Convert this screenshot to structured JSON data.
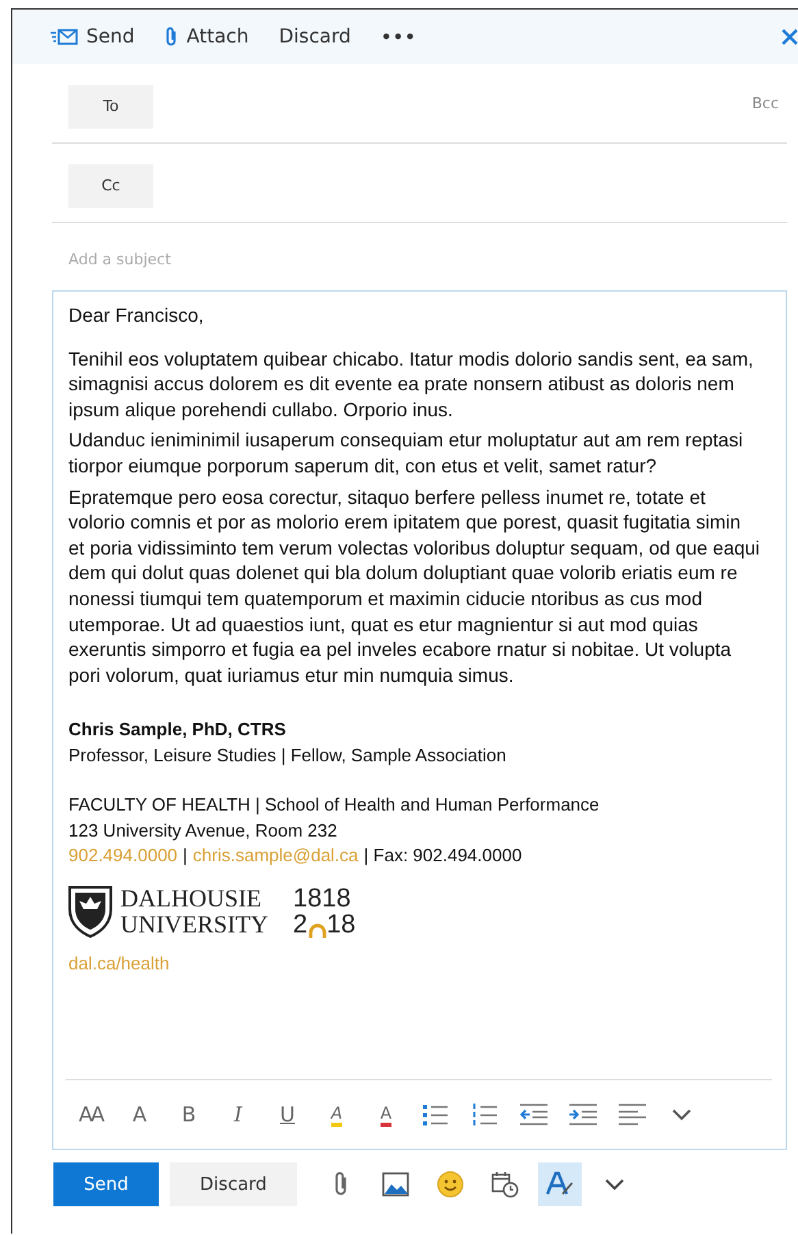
{
  "command_bar": {
    "items": [
      {
        "kind": "send",
        "label": "Send"
      },
      {
        "kind": "attach",
        "label": "Attach"
      },
      {
        "kind": "plain",
        "label": "Discard"
      },
      {
        "kind": "plain",
        "label": "•••"
      }
    ]
  },
  "recipients": {
    "to_label": "To",
    "bcc": "Bcc",
    "cc_label": "Cc"
  },
  "subject": {
    "placeholder": "Add a subject"
  },
  "body": {
    "greeting": "Dear Francisco,",
    "paragraphs": [
      "Tenihil eos voluptatem quibear chicabo. Itatur modis dolorio sandis sent, ea sam, simagnisi accus dolorem es dit evente ea prate nonsern atibust as doloris nem ipsum alique porehendi cullabo. Orporio inus.",
      "Udanduc ieniminimil iusaperum consequiam etur moluptatur aut am rem reptasi tiorpor eiumque porporum saperum dit, con etus et velit, samet ratur?",
      "Epratemque pero eosa corectur, sitaquo berfere pelless inumet re, totate et volorio comnis et por as molorio erem ipitatem que porest, quasit fugitatia simin et poria vidissiminto tem verum volectas voloribus doluptur sequam, od que eaqui dem qui dolut quas dolenet qui bla dolum doluptiant quae volorib eriatis eum re nonessi tiumqui tem quatemporum et maximin ciducie ntoribus as cus mod utemporae. Ut ad quaestios iunt, quat es etur magnientur si aut mod quias exeruntis simporro et fugia ea pel inveles ecabore rnatur si nobitae. Ut volupta pori volorum, quat iuriamus etur min numquia simus."
    ],
    "signature": {
      "name": "Chris Sample, PhD, CTRS",
      "title": "Professor, Leisure Studies | Fellow, Sample Association",
      "faculty": "FACULTY OF HEALTH | School of Health and Human Performance",
      "address": "123 University Avenue, Room 232",
      "phone": "902.494.0000",
      "separator_1": "|",
      "email": "chris.sample@dal.ca",
      "fax": "| Fax: 902.494.0000",
      "logo_line_1": "DALHOUSIE",
      "logo_line_2": "UNIVERSITY",
      "year_1": "1818",
      "year_2_start": "2",
      "year_2_end": "18",
      "website": "dal.ca/health"
    }
  },
  "format_toolbar": [
    {
      "kind": "font-size",
      "glyph": "AA"
    },
    {
      "kind": "grow",
      "glyph": "A"
    },
    {
      "kind": "bold",
      "glyph": "B"
    },
    {
      "kind": "italic",
      "glyph": "I"
    },
    {
      "kind": "underline",
      "glyph": "U"
    },
    {
      "kind": "highlight",
      "glyph": "A"
    },
    {
      "kind": "color",
      "glyph": "A"
    },
    {
      "kind": "bullets"
    },
    {
      "kind": "numbering"
    },
    {
      "kind": "outdent"
    },
    {
      "kind": "indent"
    },
    {
      "kind": "align"
    },
    {
      "kind": "more"
    }
  ],
  "action_bar": {
    "send": "Send",
    "discard": "Discard",
    "tools": [
      {
        "kind": "attach",
        "selected": false
      },
      {
        "kind": "picture",
        "selected": false
      },
      {
        "kind": "emoji",
        "selected": false
      },
      {
        "kind": "schedule",
        "selected": false
      },
      {
        "kind": "format",
        "selected": true
      },
      {
        "kind": "more",
        "selected": false
      }
    ]
  }
}
